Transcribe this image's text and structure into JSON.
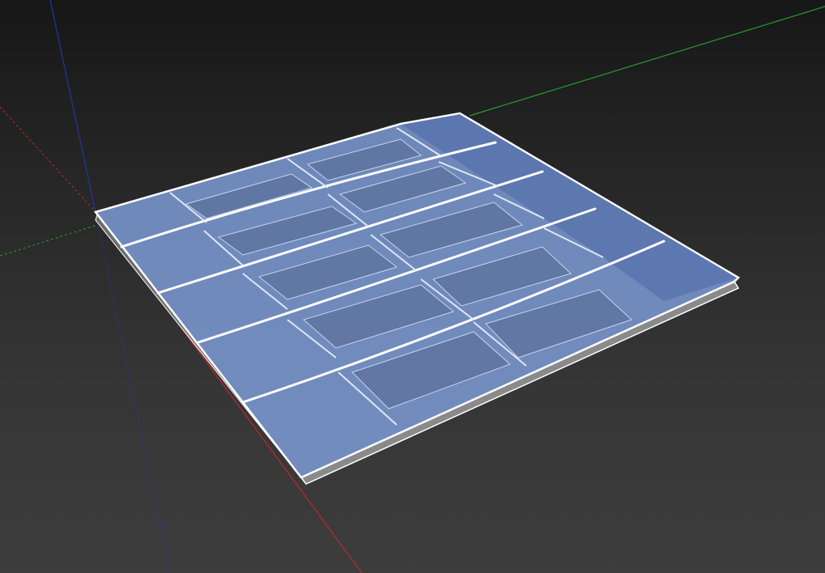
{
  "viewport": {
    "background_top": "#171717",
    "background_bottom": "#3d3d3d"
  },
  "axes": {
    "x_color": "#c0282a",
    "y_color": "#2a9a2e",
    "z_color": "#2434a8"
  },
  "model": {
    "glass_color": "#7f9fdc",
    "glass_shadow_color": "#4f69a6",
    "frame_color": "#ffffff",
    "fascia_color": "#8a8a8a",
    "column_count": 4,
    "row_count": 5
  }
}
